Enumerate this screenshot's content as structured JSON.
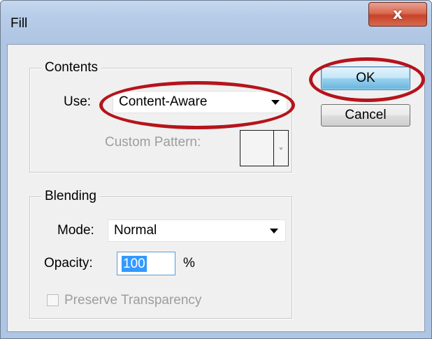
{
  "window": {
    "title": "Fill",
    "close_label": "x"
  },
  "contents": {
    "group_title": "Contents",
    "use_label": "Use:",
    "use_value": "Content-Aware",
    "custom_pattern_label": "Custom Pattern:"
  },
  "blending": {
    "group_title": "Blending",
    "mode_label": "Mode:",
    "mode_value": "Normal",
    "opacity_label": "Opacity:",
    "opacity_value": "100",
    "opacity_unit": "%",
    "preserve_label": "Preserve Transparency",
    "preserve_checked": false
  },
  "buttons": {
    "ok_label": "OK",
    "cancel_label": "Cancel"
  },
  "colors": {
    "annotation_red": "#b5141c",
    "selection_blue": "#3399ff",
    "close_red": "#c7432a"
  }
}
